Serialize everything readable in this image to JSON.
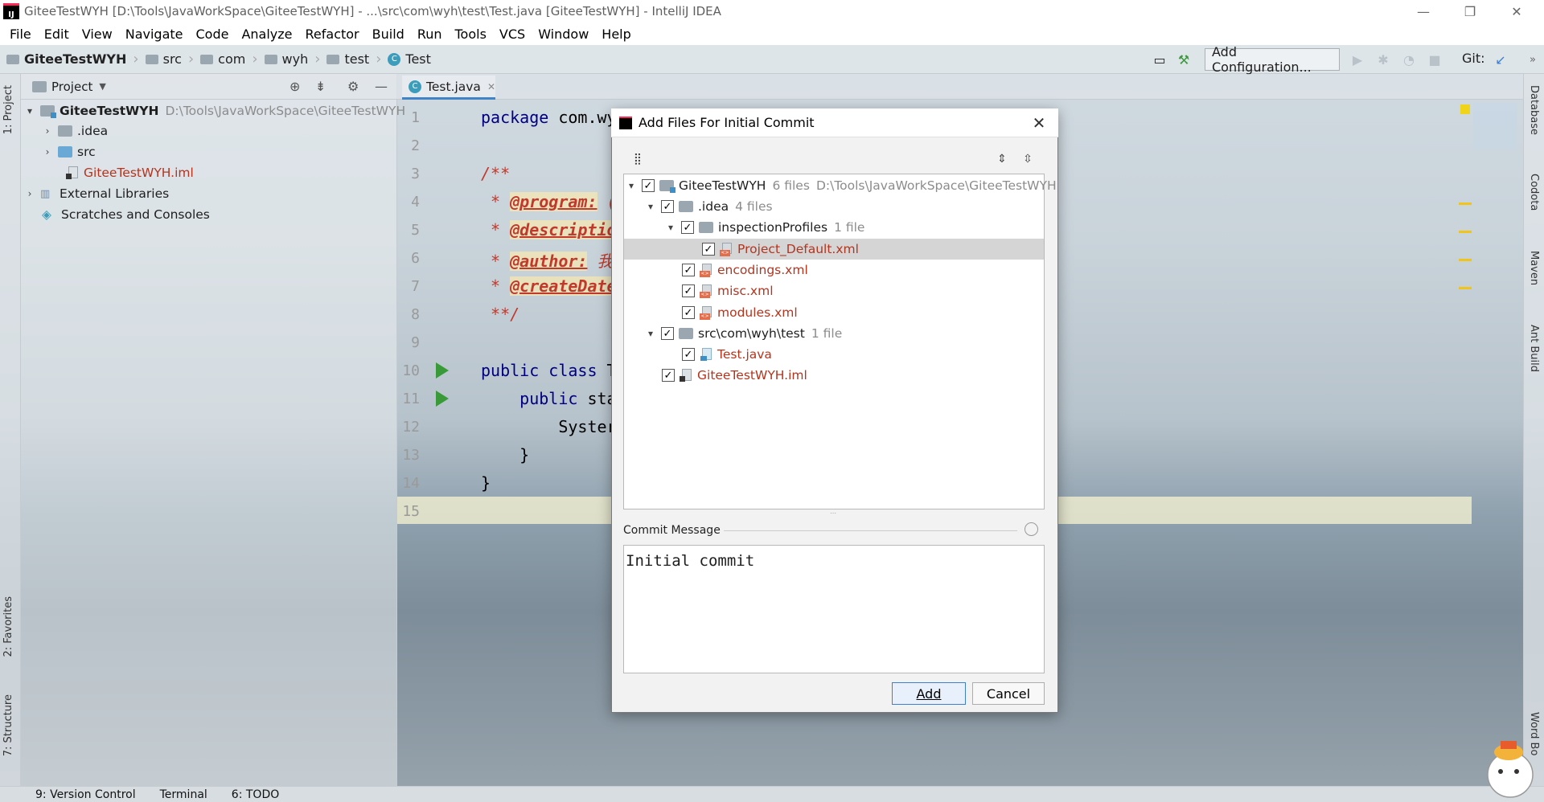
{
  "window": {
    "title": "GiteeTestWYH [D:\\Tools\\JavaWorkSpace\\GiteeTestWYH] - ...\\src\\com\\wyh\\test\\Test.java [GiteeTestWYH] - IntelliJ IDEA",
    "app_icon_text": "IJ"
  },
  "menu": [
    "File",
    "Edit",
    "View",
    "Navigate",
    "Code",
    "Analyze",
    "Refactor",
    "Build",
    "Run",
    "Tools",
    "VCS",
    "Window",
    "Help"
  ],
  "breadcrumb": [
    "GiteeTestWYH",
    "src",
    "com",
    "wyh",
    "test",
    "Test"
  ],
  "toolbar": {
    "add_configuration": "Add Configuration...",
    "git_label": "Git:"
  },
  "left_tabs": {
    "project": "1: Project",
    "favorites": "2: Favorites",
    "structure": "7: Structure"
  },
  "right_tabs": {
    "database": "Database",
    "codota": "Codota",
    "maven": "Maven",
    "ant": "Ant Build",
    "wordbook": "Word Bo"
  },
  "project_panel": {
    "title": "Project",
    "root_name": "GiteeTestWYH",
    "root_path": "D:\\Tools\\JavaWorkSpace\\GiteeTestWYH",
    "items": [
      ".idea",
      "src",
      "GiteeTestWYH.iml",
      "External Libraries",
      "Scratches and Consoles"
    ]
  },
  "editor": {
    "tab": "Test.java",
    "line_numbers": [
      "1",
      "2",
      "3",
      "4",
      "5",
      "6",
      "7",
      "8",
      "9",
      "10",
      "11",
      "12",
      "13",
      "14",
      "15"
    ],
    "lines": {
      "l1_kw": "package",
      "l1_rest": " com.wy",
      "l3": "/**",
      "l4_star": " * ",
      "l4_tag": "@program:",
      "l4_more": " (",
      "l5_star": " * ",
      "l5_tag": "@descriptio",
      "l6_star": " * ",
      "l6_tag": "@author:",
      "l6_more": " 我",
      "l7_star": " * ",
      "l7_tag": "@createDate",
      "l8": " **/",
      "l10_kw": "public class",
      "l10_rest": " T",
      "l11_kw": "    public",
      "l11_rest": " sta",
      "l12": "        Syster",
      "l13": "    }",
      "l14": "}"
    }
  },
  "bottom_tabs": [
    "9: Version Control",
    "Terminal",
    "6: TODO"
  ],
  "dialog": {
    "title": "Add Files For Initial Commit",
    "tree": {
      "root": {
        "name": "GiteeTestWYH",
        "count": "6 files",
        "path": "D:\\Tools\\JavaWorkSpace\\GiteeTestWYH"
      },
      "idea": {
        "name": ".idea",
        "count": "4 files"
      },
      "inspection": {
        "name": "inspectionProfiles",
        "count": "1 file"
      },
      "project_default": "Project_Default.xml",
      "encodings": "encodings.xml",
      "misc": "misc.xml",
      "modules": "modules.xml",
      "src": {
        "name": "src\\com\\wyh\\test",
        "count": "1 file"
      },
      "test_java": "Test.java",
      "iml": "GiteeTestWYH.iml"
    },
    "commit_label": "Commit Message",
    "commit_message": "Initial commit",
    "add_button": "Add",
    "cancel_button": "Cancel"
  },
  "colors": {
    "accent": "#4083c9",
    "vcs_added": "#b4341e",
    "run_green": "#3a9a3a"
  }
}
